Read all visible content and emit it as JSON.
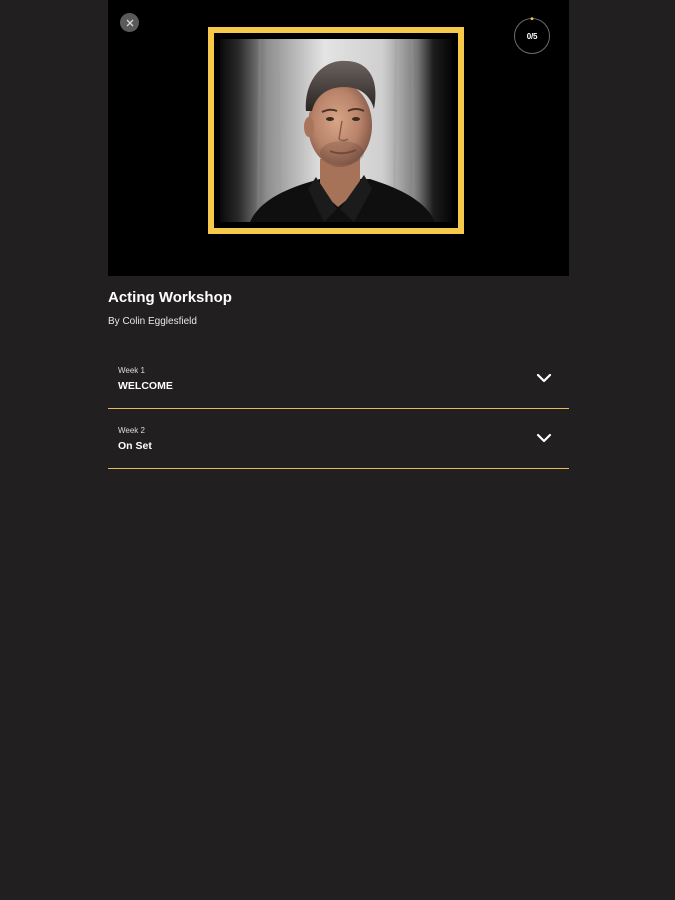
{
  "hero": {
    "close_icon": "close-icon",
    "progress_text": "0/5",
    "progress_fraction": 0,
    "photo_frame_color": "#f6c94a"
  },
  "course": {
    "title": "Acting Workshop",
    "author": "By Colin Egglesfield"
  },
  "weeks": [
    {
      "label": "Week 1",
      "title": "WELCOME",
      "icon": "chevron-down-icon"
    },
    {
      "label": "Week 2",
      "title": "On Set",
      "icon": "chevron-down-icon"
    }
  ],
  "colors": {
    "background": "#211f20",
    "accent": "#f6c94a",
    "divider": "#e7b95a"
  }
}
